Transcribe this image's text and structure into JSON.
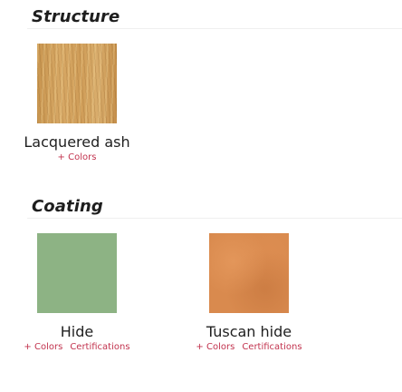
{
  "sections": [
    {
      "title": "Structure",
      "items": [
        {
          "name": "Lacquered ash",
          "swatch": "wood",
          "links": [
            "+ Colors"
          ]
        }
      ]
    },
    {
      "title": "Coating",
      "items": [
        {
          "name": "Hide",
          "swatch": "#8db384",
          "links": [
            "+ Colors",
            "Certifications"
          ]
        },
        {
          "name": "Tuscan hide",
          "swatch": "#d98a4e",
          "links": [
            "+ Colors",
            "Certifications"
          ]
        }
      ]
    }
  ],
  "colors": {
    "link": "#c2334e",
    "text": "#1f1f1f"
  }
}
